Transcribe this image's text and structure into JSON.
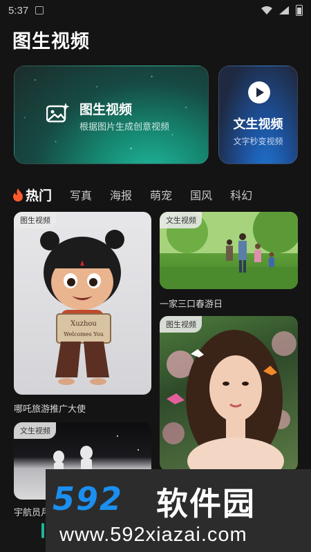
{
  "status_bar": {
    "time": "5:37"
  },
  "page": {
    "title": "图生视频"
  },
  "feature_cards": {
    "main": {
      "title": "图生视频",
      "subtitle": "根据图片生成创意视频",
      "icon": "image-sparkle-icon"
    },
    "side": {
      "title": "文生视频",
      "subtitle": "文字秒变视频",
      "icon": "play-icon"
    }
  },
  "tabs": [
    {
      "label": "热门",
      "icon": "fire-icon",
      "active": true
    },
    {
      "label": "写真"
    },
    {
      "label": "海报"
    },
    {
      "label": "萌宠"
    },
    {
      "label": "国风"
    },
    {
      "label": "科幻"
    }
  ],
  "tiles": [
    {
      "tag": "图生视频",
      "caption": "哪吒旅游推广大使",
      "sign_line1": "Xuzhou",
      "sign_line2": "Welcomes You"
    },
    {
      "tag": "文生视频",
      "caption": "一家三口春游日"
    },
    {
      "tag": "图生视频"
    },
    {
      "tag": "文生视频",
      "caption": "宇航员月"
    }
  ],
  "watermark": {
    "logo": "592",
    "name": "软件园",
    "url": "www.592xiazai.com"
  },
  "colors": {
    "background": "#141414",
    "accent_teal": "#1fb59a",
    "accent_blue": "#1b8ff0"
  }
}
